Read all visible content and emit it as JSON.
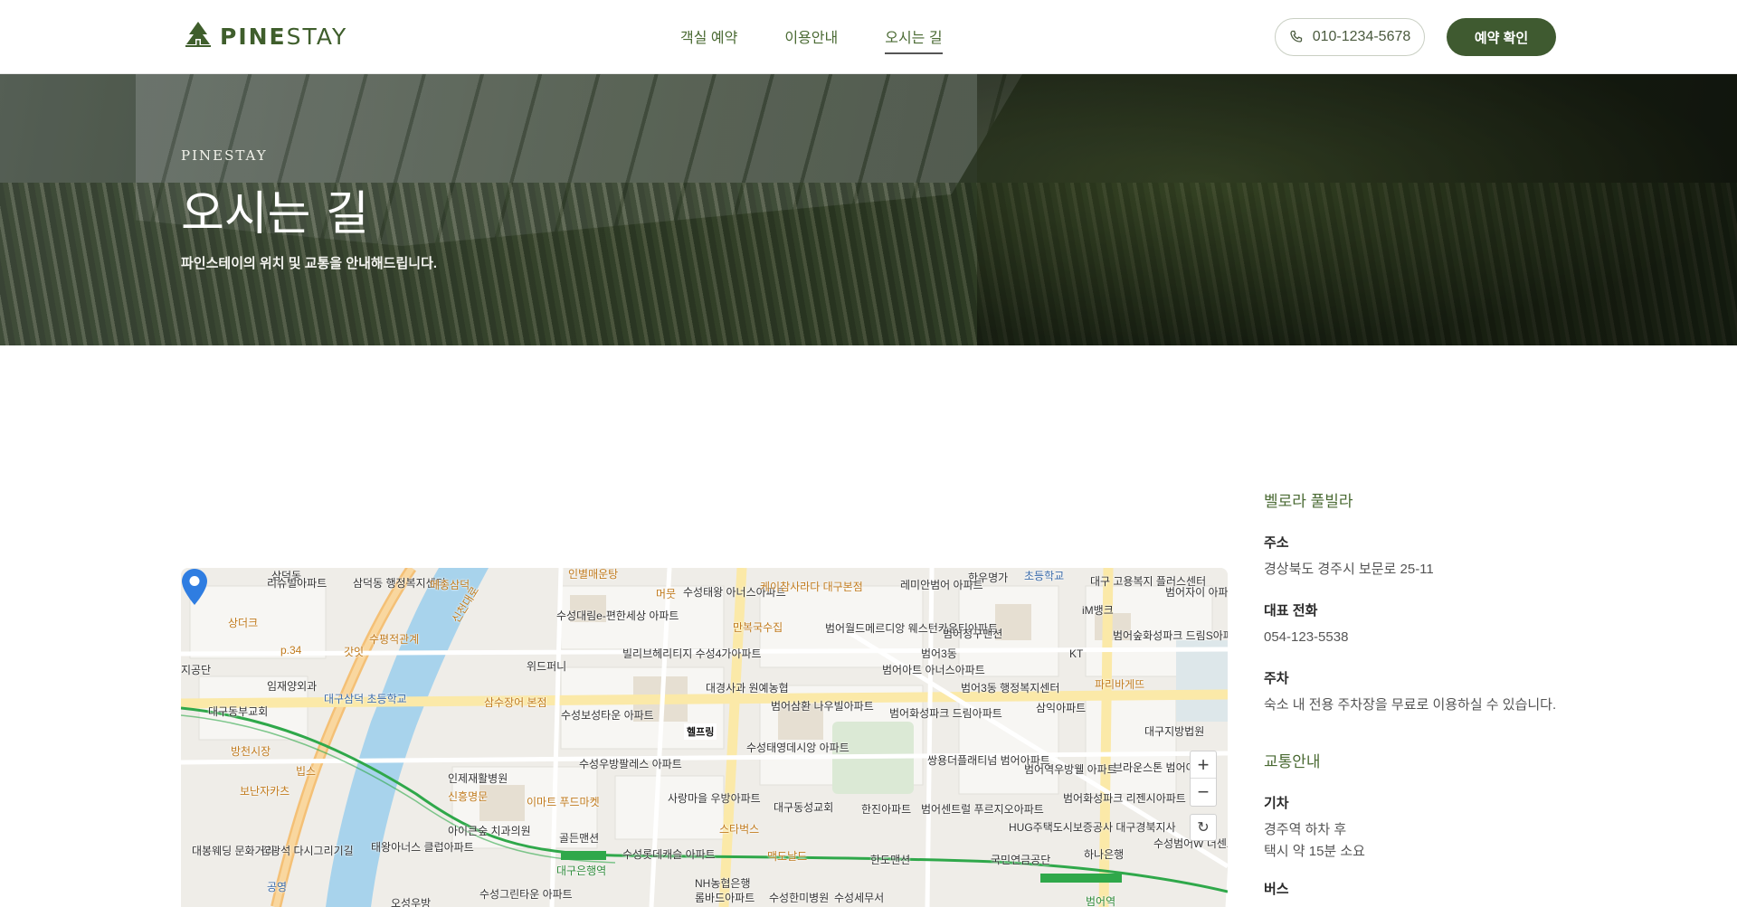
{
  "header": {
    "logo_bold": "PINE",
    "logo_light": "STAY",
    "nav": [
      "객실 예약",
      "이용안내",
      "오시는 길"
    ],
    "phone": "010-1234-5678",
    "book_button": "예약 확인"
  },
  "hero": {
    "eyebrow": "PINESTAY",
    "title": "오시는 길",
    "subtitle": "파인스테이의 위치 및 교통을 안내해드립니다."
  },
  "map": {
    "pin_label": "헬프링",
    "zoom_in": "+",
    "zoom_out": "−",
    "reset": "↻",
    "labels": [
      "삼덕동",
      "리슈빌아파트",
      "삼덕동 행정복지센터",
      "메종삼덕",
      "신천대로",
      "인별매운탕",
      "머뭇",
      "수성태왕 아너스아파트",
      "케이참사라다 대구본점",
      "레미안범어 아파트",
      "한우명가",
      "초등학교",
      "대구 고용복지 플러스센터",
      "범어자이 아파트",
      "상더크",
      "수성대림e-편한세상 아파트",
      "만복국수집",
      "범어월드메르디앙 웨스턴카운티아파트",
      "범어청구맨션",
      "iM뱅크",
      "범어숲화성파크 드림S아파트",
      "p.34",
      "갓잇",
      "수평적관계",
      "위드퍼니",
      "빌리브헤리티지 수성4가아파트",
      "범어3동",
      "KT",
      "파리바게뜨",
      "지공단",
      "임재양외과",
      "대구삼덕 초등학교",
      "삼수장어 본점",
      "대경사과 원예농협",
      "범어아트 아너스아파트",
      "범어3동 행정복지센터",
      "대구동부교회",
      "수성보성타운 아파트",
      "범어삼환 나우빌아파트",
      "범어화성파크 드림아파트",
      "삼익아파트",
      "대구지방법원",
      "방천시장",
      "수성우방팔레스 아파트",
      "수성태영데시앙 아파트",
      "쌍용더플래티넘 범어아파트",
      "범어역우방웰 아파트",
      "브라운스톤 범어아파트",
      "빕스",
      "인제재활병원",
      "보난자카츠",
      "신흥명문",
      "이마트 푸드마켓",
      "사랑마을 우방아파트",
      "대구동성교회",
      "한진아파트",
      "범어센트럴 푸르지오아파트",
      "범어화성파크 리젠시아파트",
      "스타벅스",
      "아이큰숲 치과의원",
      "태왕아너스 클럽아파트",
      "김광석 다시그리기길",
      "대봉웨딩 문화거리",
      "골든맨션",
      "수성롯데캐슬 아파트",
      "맥도날드",
      "한도맨션",
      "HUG주택도시보증공사 대구경북지사",
      "국민연금공단",
      "하나은행",
      "수성범어W 더센트럴아파트",
      "공영",
      "오성우방",
      "수성그린타운 아파트",
      "NH농협은행",
      "롬바드아파트",
      "수성한미병원",
      "수성세무서",
      "대구은행역",
      "범어역"
    ]
  },
  "info": {
    "place_name": "벨로라 풀빌라",
    "address_label": "주소",
    "address": "경상북도 경주시 보문로 25-11",
    "phone_label": "대표 전화",
    "phone": "054-123-5538",
    "parking_label": "주차",
    "parking": "숙소 내 전용 주차장을 무료로 이용하실 수 있습니다.",
    "transport_title": "교통안내",
    "train_label": "기차",
    "train_line1": "경주역 하차 후",
    "train_line2": "택시 약 15분 소요",
    "bus_label": "버스"
  },
  "colors": {
    "brand_green": "#3f5a30",
    "accent_text": "#4a6a33"
  }
}
